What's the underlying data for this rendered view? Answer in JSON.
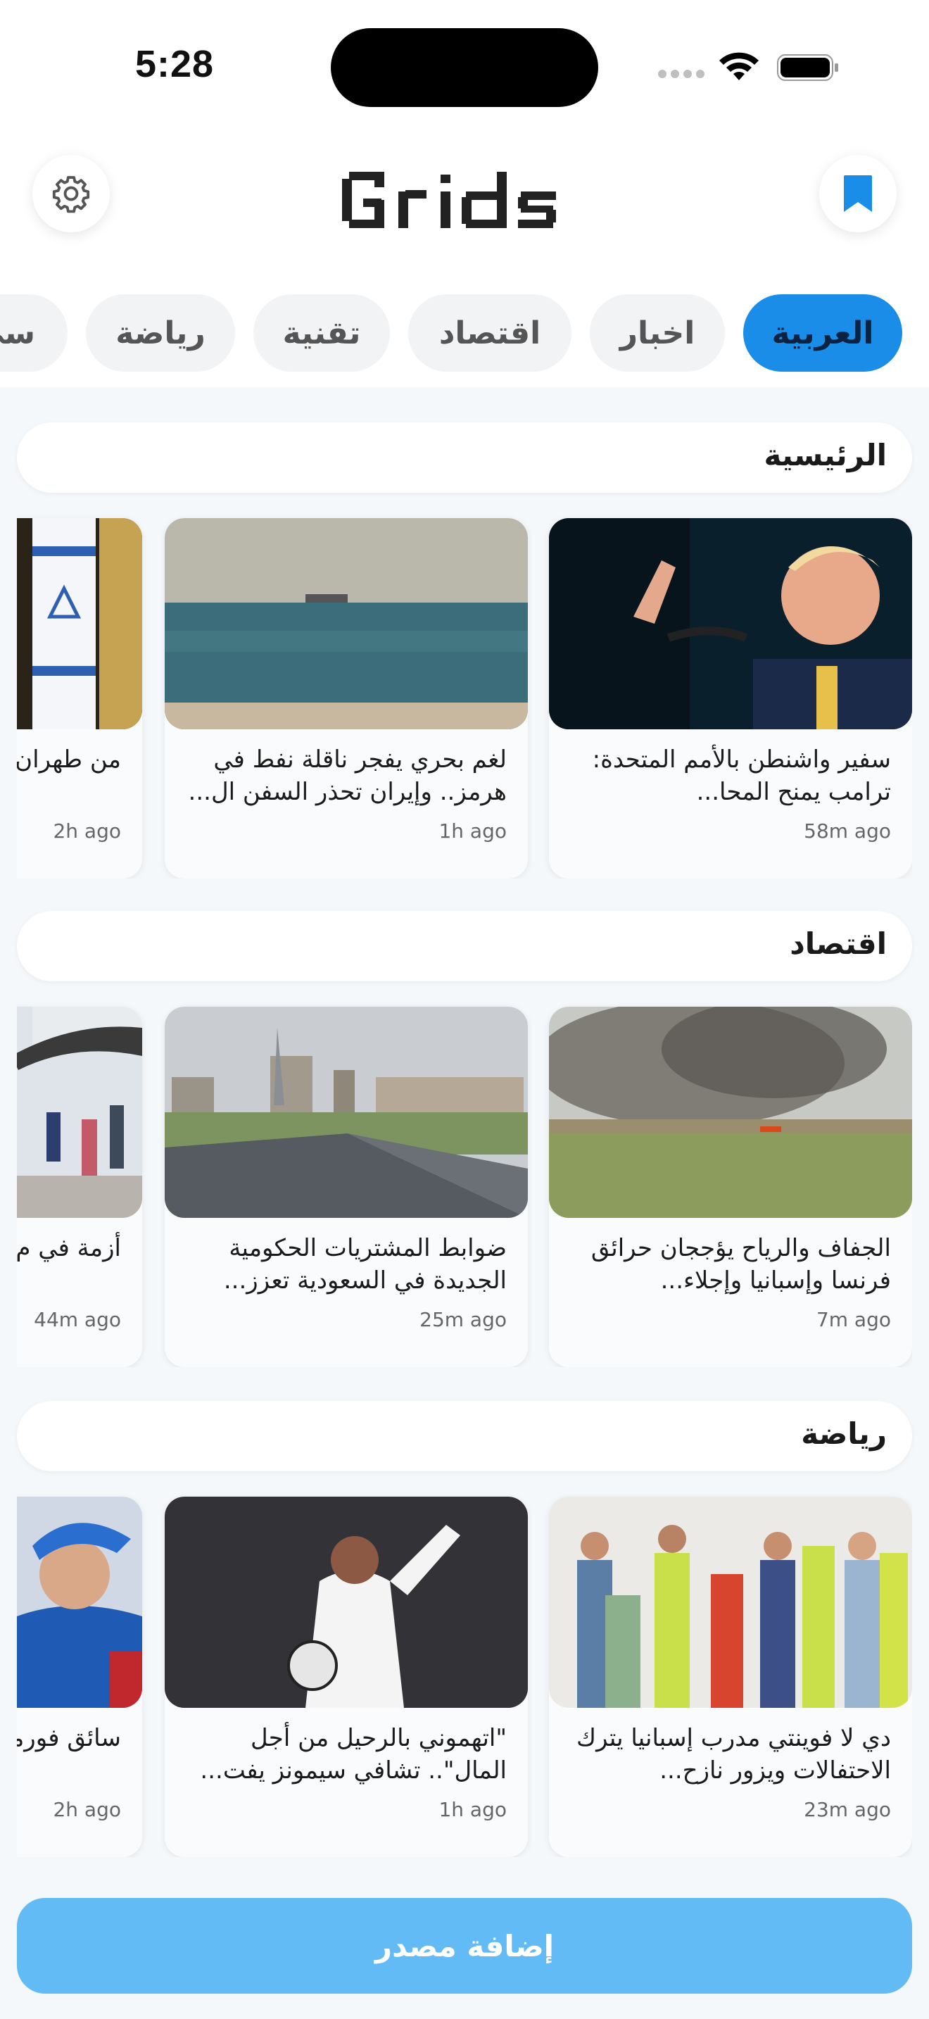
{
  "status_bar": {
    "time": "5:28"
  },
  "header": {
    "logo_text": "Grids",
    "settings_icon": "gear-icon",
    "bookmark_icon": "bookmark-icon"
  },
  "tabs": [
    {
      "label": "العربية",
      "active": true
    },
    {
      "label": "اخبار",
      "active": false
    },
    {
      "label": "اقتصاد",
      "active": false
    },
    {
      "label": "تقنية",
      "active": false
    },
    {
      "label": "رياضة",
      "active": false
    },
    {
      "label": "سي",
      "active": false
    }
  ],
  "sections": [
    {
      "title": "الرئيسية",
      "cards": [
        {
          "title": "سفير واشنطن بالأمم المتحدة: ترامب يمنح المحا...",
          "age": "58m ago"
        },
        {
          "title": "لغم بحري يفجر ناقلة نفط في هرمز.. وإيران تحذر السفن ال...",
          "age": "1h ago"
        },
        {
          "title": "من طهران ساخنة على",
          "age": "2h ago"
        }
      ]
    },
    {
      "title": "اقتصاد",
      "cards": [
        {
          "title": "الجفاف والرياح يؤججان حرائق فرنسا وإسبانيا وإجلاء...",
          "age": "7m ago"
        },
        {
          "title": "ضوابط المشتريات الحكومية الجديدة في السعودية تعزز...",
          "age": "25m ago"
        },
        {
          "title": "أزمة في م انقطاع ال",
          "age": "44m ago"
        }
      ]
    },
    {
      "title": "رياضة",
      "cards": [
        {
          "title": "دي لا فوينتي مدرب إسبانيا يترك الاحتفالات ويزور نازح...",
          "age": "23m ago"
        },
        {
          "title": "\"اتهموني بالرحيل من أجل المال\".. تشافي سيمونز يفت...",
          "age": "1h ago"
        },
        {
          "title": "سائق فورمولا من الإسبان",
          "age": "2h ago"
        }
      ]
    }
  ],
  "add_source_label": "إضافة مصدر",
  "colors": {
    "accent": "#1a8de8",
    "button": "#63bbf5",
    "background": "#f5f8fb"
  }
}
